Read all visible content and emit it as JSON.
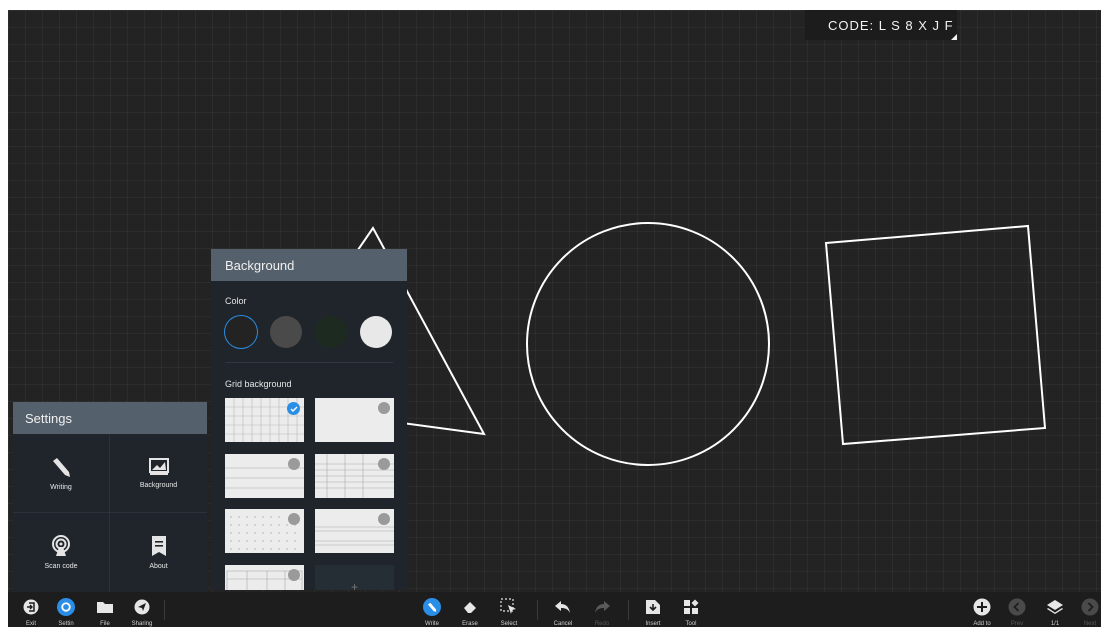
{
  "code_badge": {
    "text": "CODE:  L S 8 X J F"
  },
  "settings_panel": {
    "title": "Settings",
    "items": [
      {
        "label": "Writing",
        "icon": "pen-icon"
      },
      {
        "label": "Background",
        "icon": "background-image-icon"
      },
      {
        "label": "Scan code",
        "icon": "broadcast-icon"
      },
      {
        "label": "About",
        "icon": "bookmark-icon"
      }
    ]
  },
  "background_panel": {
    "title": "Background",
    "color_label": "Color",
    "grid_label": "Grid background",
    "colors": [
      "#232323",
      "#4a4a4a",
      "#1c2a1f",
      "#e8e8e8"
    ],
    "selected_color": "#232323",
    "selected_grid": "grid-square",
    "add_symbol": "+"
  },
  "toolbar": {
    "left": [
      {
        "label": "Exit",
        "icon": "exit-icon"
      },
      {
        "label": "Settin",
        "icon": "settings-icon"
      },
      {
        "label": "File",
        "icon": "folder-icon"
      },
      {
        "label": "Sharing",
        "icon": "send-icon"
      }
    ],
    "center": [
      {
        "label": "Write",
        "icon": "pen-icon"
      },
      {
        "label": "Erase",
        "icon": "eraser-icon"
      },
      {
        "label": "Select",
        "icon": "select-icon"
      },
      {
        "label": "Cancel",
        "icon": "undo-icon"
      },
      {
        "label": "Redo",
        "icon": "redo-icon"
      },
      {
        "label": "Insert",
        "icon": "insert-icon"
      },
      {
        "label": "Tool",
        "icon": "apps-icon"
      }
    ],
    "right": [
      {
        "label": "Add to",
        "icon": "add-page-icon"
      },
      {
        "label": "Prev",
        "icon": "prev-page-icon"
      },
      {
        "label": "1/1",
        "icon": "layers-icon"
      },
      {
        "label": "Next",
        "icon": "next-page-icon"
      }
    ]
  },
  "colors": {
    "accent": "#2a8de6",
    "canvas": "#232323",
    "panel": "#1f252b",
    "panel_header": "#54606b"
  }
}
